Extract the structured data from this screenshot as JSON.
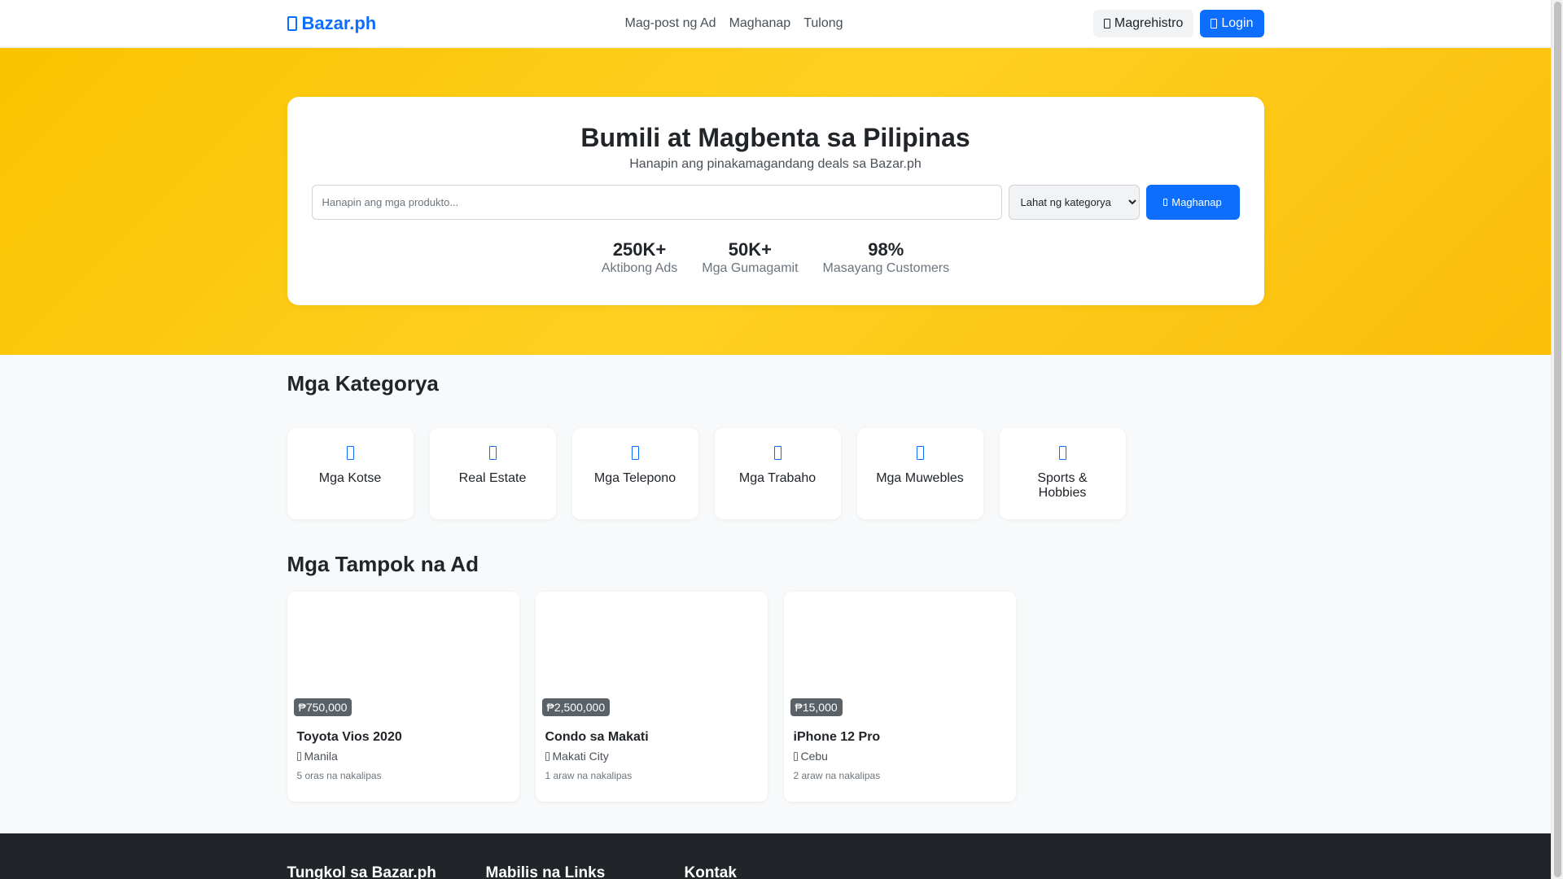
{
  "navbar": {
    "brand": "Bazar.ph",
    "links": [
      "Mag-post ng Ad",
      "Maghanap",
      "Tulong"
    ],
    "register_label": "Magrehistro",
    "login_label": "Login"
  },
  "hero": {
    "title": "Bumili at Magbenta sa Pilipinas",
    "subtitle": "Hanapin ang pinakamagandang deals sa Bazar.ph",
    "search": {
      "placeholder": "Hanapin ang mga produkto...",
      "value": ""
    },
    "category_select": {
      "selected": "Lahat ng kategorya"
    },
    "search_button": "Maghanap",
    "stats": [
      {
        "value": "250K+",
        "label": "Aktibong Ads"
      },
      {
        "value": "50K+",
        "label": "Mga Gumagamit"
      },
      {
        "value": "98%",
        "label": "Masayang Customers"
      }
    ]
  },
  "categories": {
    "title": "Mga Kategorya",
    "items": [
      {
        "label": "Mga Kotse",
        "icon": "car-icon"
      },
      {
        "label": "Real Estate",
        "icon": "building-icon"
      },
      {
        "label": "Mga Telepono",
        "icon": "phone-icon"
      },
      {
        "label": "Mga Trabaho",
        "icon": "briefcase-icon"
      },
      {
        "label": "Mga Muwebles",
        "icon": "couch-icon"
      },
      {
        "label": "Sports & Hobbies",
        "icon": "football-icon"
      }
    ]
  },
  "featured": {
    "title": "Mga Tampok na Ad",
    "ads": [
      {
        "price": "₱750,000",
        "title": "Toyota Vios 2020",
        "location": "Manila",
        "time": "5 oras na nakalipas"
      },
      {
        "price": "₱2,500,000",
        "title": "Condo sa Makati",
        "location": "Makati City",
        "time": "1 araw na nakalipas"
      },
      {
        "price": "₱15,000",
        "title": "iPhone 12 Pro",
        "location": "Cebu",
        "time": "2 araw na nakalipas"
      }
    ]
  },
  "footer": {
    "headings": [
      "Tungkol sa Bazar.ph",
      "Mabilis na Links",
      "Kontak"
    ]
  },
  "colors": {
    "primary": "#0d6efd",
    "hero_gradient": "#fbc300",
    "footer_bg": "#212529"
  }
}
